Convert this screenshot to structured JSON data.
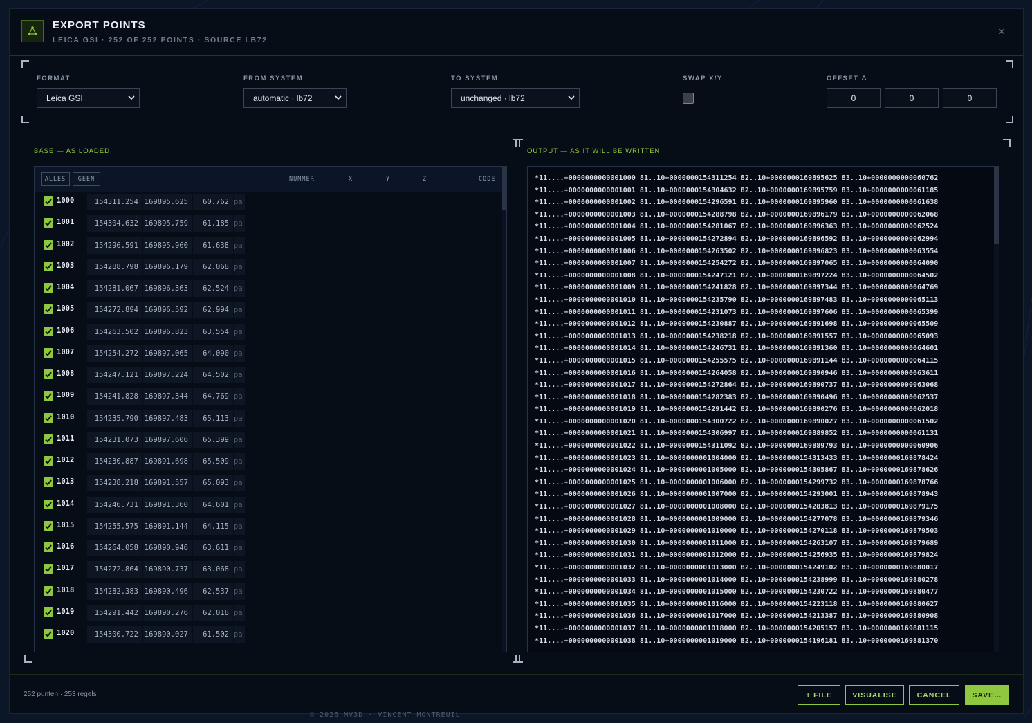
{
  "window": {
    "title": "EXPORT POINTS",
    "subtitle": "LEICA GSI · 252 OF 252 POINTS · SOURCE LB72",
    "close_icon": "×"
  },
  "options": {
    "format": {
      "label": "FORMAT",
      "value": "Leica GSI"
    },
    "from_system": {
      "label": "FROM SYSTEM",
      "value": "automatic · lb72"
    },
    "to_system": {
      "label": "TO SYSTEM",
      "value": "unchanged · lb72"
    },
    "swap": {
      "label": "SWAP X/Y",
      "checked": false
    },
    "offset": {
      "label": "OFFSET Δ",
      "values": [
        "0",
        "0",
        "0"
      ]
    }
  },
  "base_pane": {
    "label": "BASE — AS LOADED",
    "buttons": {
      "all": "ALLES",
      "none": "GEEN"
    },
    "columns": {
      "number": "NUMMER",
      "x": "X",
      "y": "Y",
      "z": "Z",
      "code": "CODE"
    },
    "rows": [
      {
        "num": "1000",
        "x": "154311.254",
        "y": "169895.625",
        "z": "60.762",
        "code": "pa"
      },
      {
        "num": "1001",
        "x": "154304.632",
        "y": "169895.759",
        "z": "61.185",
        "code": "pa"
      },
      {
        "num": "1002",
        "x": "154296.591",
        "y": "169895.960",
        "z": "61.638",
        "code": "pa"
      },
      {
        "num": "1003",
        "x": "154288.798",
        "y": "169896.179",
        "z": "62.068",
        "code": "pa"
      },
      {
        "num": "1004",
        "x": "154281.067",
        "y": "169896.363",
        "z": "62.524",
        "code": "pa"
      },
      {
        "num": "1005",
        "x": "154272.894",
        "y": "169896.592",
        "z": "62.994",
        "code": "pa"
      },
      {
        "num": "1006",
        "x": "154263.502",
        "y": "169896.823",
        "z": "63.554",
        "code": "pa"
      },
      {
        "num": "1007",
        "x": "154254.272",
        "y": "169897.065",
        "z": "64.090",
        "code": "pa"
      },
      {
        "num": "1008",
        "x": "154247.121",
        "y": "169897.224",
        "z": "64.502",
        "code": "pa"
      },
      {
        "num": "1009",
        "x": "154241.828",
        "y": "169897.344",
        "z": "64.769",
        "code": "pa"
      },
      {
        "num": "1010",
        "x": "154235.790",
        "y": "169897.483",
        "z": "65.113",
        "code": "pa"
      },
      {
        "num": "1011",
        "x": "154231.073",
        "y": "169897.606",
        "z": "65.399",
        "code": "pa"
      },
      {
        "num": "1012",
        "x": "154230.887",
        "y": "169891.698",
        "z": "65.509",
        "code": "pa"
      },
      {
        "num": "1013",
        "x": "154238.218",
        "y": "169891.557",
        "z": "65.093",
        "code": "pa"
      },
      {
        "num": "1014",
        "x": "154246.731",
        "y": "169891.360",
        "z": "64.601",
        "code": "pa"
      },
      {
        "num": "1015",
        "x": "154255.575",
        "y": "169891.144",
        "z": "64.115",
        "code": "pa"
      },
      {
        "num": "1016",
        "x": "154264.058",
        "y": "169890.946",
        "z": "63.611",
        "code": "pa"
      },
      {
        "num": "1017",
        "x": "154272.864",
        "y": "169890.737",
        "z": "63.068",
        "code": "pa"
      },
      {
        "num": "1018",
        "x": "154282.383",
        "y": "169890.496",
        "z": "62.537",
        "code": "pa"
      },
      {
        "num": "1019",
        "x": "154291.442",
        "y": "169890.276",
        "z": "62.018",
        "code": "pa"
      },
      {
        "num": "1020",
        "x": "154300.722",
        "y": "169890.027",
        "z": "61.502",
        "code": "pa"
      }
    ]
  },
  "output_pane": {
    "label": "OUTPUT — AS IT WILL BE WRITTEN",
    "lines": [
      "*11....+0000000000001000 81..10+0000000154311254 82..10+0000000169895625 83..10+0000000000060762",
      "*11....+0000000000001001 81..10+0000000154304632 82..10+0000000169895759 83..10+0000000000061185",
      "*11....+0000000000001002 81..10+0000000154296591 82..10+0000000169895960 83..10+0000000000061638",
      "*11....+0000000000001003 81..10+0000000154288798 82..10+0000000169896179 83..10+0000000000062068",
      "*11....+0000000000001004 81..10+0000000154281067 82..10+0000000169896363 83..10+0000000000062524",
      "*11....+0000000000001005 81..10+0000000154272894 82..10+0000000169896592 83..10+0000000000062994",
      "*11....+0000000000001006 81..10+0000000154263502 82..10+0000000169896823 83..10+0000000000063554",
      "*11....+0000000000001007 81..10+0000000154254272 82..10+0000000169897065 83..10+0000000000064090",
      "*11....+0000000000001008 81..10+0000000154247121 82..10+0000000169897224 83..10+0000000000064502",
      "*11....+0000000000001009 81..10+0000000154241828 82..10+0000000169897344 83..10+0000000000064769",
      "*11....+0000000000001010 81..10+0000000154235790 82..10+0000000169897483 83..10+0000000000065113",
      "*11....+0000000000001011 81..10+0000000154231073 82..10+0000000169897606 83..10+0000000000065399",
      "*11....+0000000000001012 81..10+0000000154230887 82..10+0000000169891698 83..10+0000000000065509",
      "*11....+0000000000001013 81..10+0000000154238218 82..10+0000000169891557 83..10+0000000000065093",
      "*11....+0000000000001014 81..10+0000000154246731 82..10+0000000169891360 83..10+0000000000064601",
      "*11....+0000000000001015 81..10+0000000154255575 82..10+0000000169891144 83..10+0000000000064115",
      "*11....+0000000000001016 81..10+0000000154264058 82..10+0000000169890946 83..10+0000000000063611",
      "*11....+0000000000001017 81..10+0000000154272864 82..10+0000000169890737 83..10+0000000000063068",
      "*11....+0000000000001018 81..10+0000000154282383 82..10+0000000169890496 83..10+0000000000062537",
      "*11....+0000000000001019 81..10+0000000154291442 82..10+0000000169890276 83..10+0000000000062018",
      "*11....+0000000000001020 81..10+0000000154300722 82..10+0000000169890027 83..10+0000000000061502",
      "*11....+0000000000001021 81..10+0000000154306997 82..10+0000000169889852 83..10+0000000000061131",
      "*11....+0000000000001022 81..10+0000000154311092 82..10+0000000169889793 83..10+0000000000060906",
      "*11....+0000000000001023 81..10+0000000001004000 82..10+0000000154313433 83..10+0000000169878424",
      "*11....+0000000000001024 81..10+0000000001005000 82..10+0000000154305867 83..10+0000000169878626",
      "*11....+0000000000001025 81..10+0000000001006000 82..10+0000000154299732 83..10+0000000169878766",
      "*11....+0000000000001026 81..10+0000000001007000 82..10+0000000154293001 83..10+0000000169878943",
      "*11....+0000000000001027 81..10+0000000001008000 82..10+0000000154283813 83..10+0000000169879175",
      "*11....+0000000000001028 81..10+0000000001009000 82..10+0000000154277078 83..10+0000000169879346",
      "*11....+0000000000001029 81..10+0000000001010000 82..10+0000000154270118 83..10+0000000169879503",
      "*11....+0000000000001030 81..10+0000000001011000 82..10+0000000154263107 83..10+0000000169879689",
      "*11....+0000000000001031 81..10+0000000001012000 82..10+0000000154256935 83..10+0000000169879824",
      "*11....+0000000000001032 81..10+0000000001013000 82..10+0000000154249102 83..10+0000000169880017",
      "*11....+0000000000001033 81..10+0000000001014000 82..10+0000000154238999 83..10+0000000169880278",
      "*11....+0000000000001034 81..10+0000000001015000 82..10+0000000154230722 83..10+0000000169880477",
      "*11....+0000000000001035 81..10+0000000001016000 82..10+0000000154223118 83..10+0000000169880627",
      "*11....+0000000000001036 81..10+0000000001017000 82..10+0000000154213387 83..10+0000000169880908",
      "*11....+0000000000001037 81..10+0000000001018000 82..10+0000000154205157 83..10+0000000169881115",
      "*11....+0000000000001038 81..10+0000000001019000 82..10+0000000154196181 83..10+0000000169881370"
    ]
  },
  "footer": {
    "status": "252 punten · 253 regels",
    "buttons": {
      "file": "+ FILE",
      "visualise": "VISUALISE",
      "cancel": "CANCEL",
      "save": "SAVE…"
    },
    "credit": "© 2026 MV3D · VINCENT MONTREUIL"
  },
  "colors": {
    "accent": "#8fc83f",
    "background": "#070d17",
    "page": "#0b1626"
  }
}
